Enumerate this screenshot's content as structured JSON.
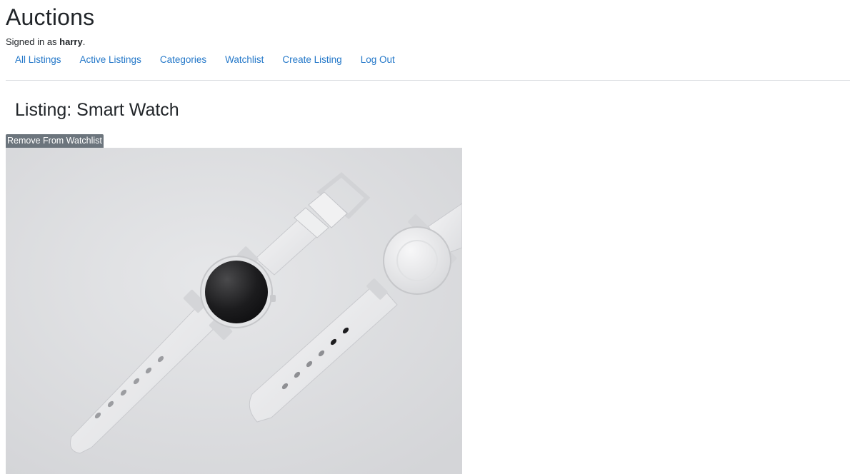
{
  "header": {
    "site_title": "Auctions",
    "signed_in_prefix": "Signed in as ",
    "username": "harry",
    "signed_in_suffix": "."
  },
  "nav": {
    "items": [
      {
        "label": "All Listings"
      },
      {
        "label": "Active Listings"
      },
      {
        "label": "Categories"
      },
      {
        "label": "Watchlist"
      },
      {
        "label": "Create Listing"
      },
      {
        "label": "Log Out"
      }
    ]
  },
  "listing": {
    "title": "Listing: Smart Watch",
    "watchlist_button_label": "Remove From Watchlist",
    "image_alt": "Smart Watch"
  },
  "colors": {
    "link": "#2478c9",
    "button_bg": "#6c757d",
    "image_bg": "#dedfe1"
  }
}
